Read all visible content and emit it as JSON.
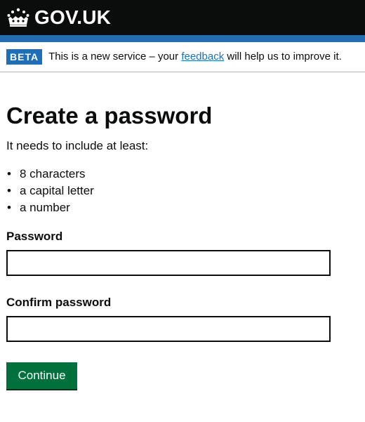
{
  "header": {
    "logo_text": "GOV.UK",
    "logo_icon": "crown-icon",
    "background_color": "#0b0c0c",
    "stripe_color": "#1d70b8"
  },
  "phase_banner": {
    "tag": "BETA",
    "text_before": "This is a new service – your ",
    "link_text": "feedback",
    "text_after": " will help us to improve it."
  },
  "main": {
    "title": "Create a password",
    "intro": "It needs to include at least:",
    "requirements": [
      "8 characters",
      "a capital letter",
      "a number"
    ],
    "bullet": "•"
  },
  "form": {
    "password_label": "Password",
    "password_value": "",
    "confirm_label": "Confirm password",
    "confirm_value": "",
    "submit_label": "Continue",
    "button_color": "#00703c"
  }
}
